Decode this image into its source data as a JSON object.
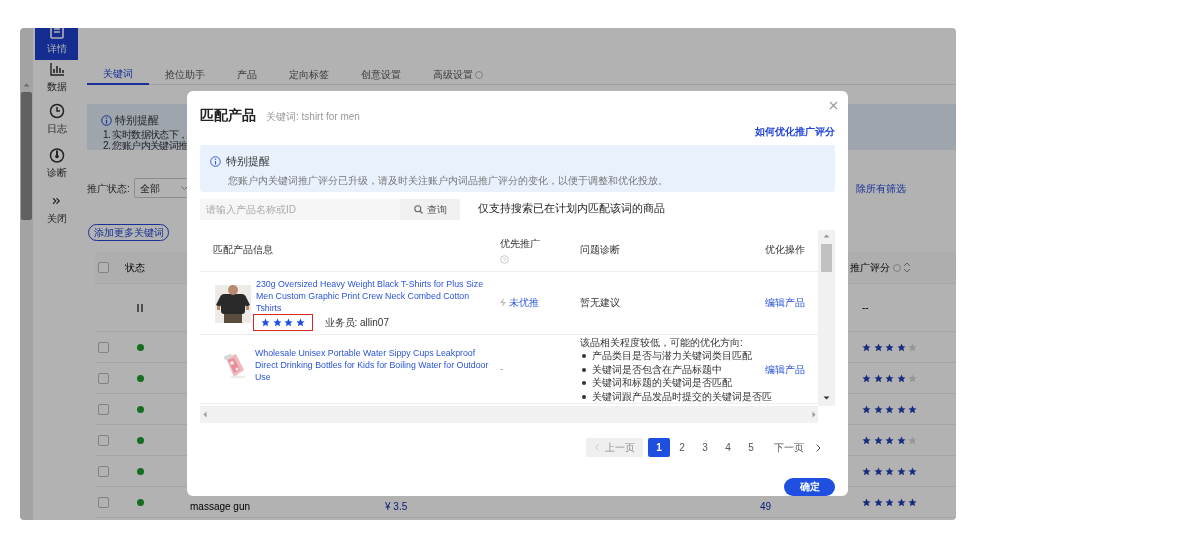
{
  "sidebar": {
    "items": [
      {
        "label": "详情",
        "kind": "document",
        "selected": true
      },
      {
        "label": "数据",
        "kind": "chart",
        "selected": false
      },
      {
        "label": "日志",
        "kind": "clock",
        "selected": false
      },
      {
        "label": "诊断",
        "kind": "gauge",
        "selected": false
      },
      {
        "label": "关闭",
        "kind": "collapse",
        "selected": false
      }
    ]
  },
  "tabs": [
    {
      "label": "关键词",
      "selected": true
    },
    {
      "label": "抢位助手",
      "selected": false
    },
    {
      "label": "产品",
      "selected": false
    },
    {
      "label": "定向标签",
      "selected": false
    },
    {
      "label": "创意设置",
      "selected": false
    },
    {
      "label": "高级设置",
      "selected": false,
      "help": true
    }
  ],
  "notice": {
    "title": "特别提醒",
    "lines": [
      "1. 实时数据状态下，",
      "2. 您账户内关键词推"
    ]
  },
  "filter": {
    "label": "推广状态:",
    "value": "全部",
    "clear": "除所有筛选"
  },
  "add_button": "添加更多关键词",
  "keyword_table": {
    "select_all": {
      "checked": false
    },
    "status_header": "状态",
    "score_header": "推广评分",
    "rows": [
      {
        "paused": true,
        "score": "--"
      },
      {
        "paused": false,
        "checked": false,
        "stars": 4
      },
      {
        "paused": false,
        "checked": false,
        "stars": 4
      },
      {
        "paused": false,
        "checked": false,
        "stars": 5
      },
      {
        "paused": false,
        "checked": false,
        "stars": 4
      },
      {
        "paused": false,
        "checked": false,
        "stars": 5
      },
      {
        "paused": false,
        "checked": false,
        "name": "massage gun",
        "price": "¥ 3.5",
        "column_6": "49",
        "stars": 5
      }
    ]
  },
  "modal": {
    "title": "匹配产品",
    "keyword": "关键词: tshirt for men",
    "help_link": "如何优化推广评分",
    "notice": {
      "title": "特别提醒",
      "text": "您账户内关键词推广评分已升级，请及时关注账户内词品推广评分的变化，以便于调整和优化投放。"
    },
    "search": {
      "placeholder": "请输入产品名称或ID",
      "button": "查询",
      "note": "仅支持搜索已在计划内匹配该词的商品"
    },
    "columns": [
      {
        "label": "匹配产品信息"
      },
      {
        "label": "优先推广",
        "help": true
      },
      {
        "label": "问题诊断"
      },
      {
        "label": "优化操作"
      }
    ],
    "rows": [
      {
        "image": {
          "kind": "picture"
        },
        "title": "230g Oversized Heavy Weight Black T-Shirts for Plus Size Men Custom Graphic Print Crew Neck Combed Cotton Tshirts",
        "stars": 4,
        "highlighted": true,
        "salesperson": "业务员: allin07",
        "priority": "未优推",
        "priority_active": true,
        "diagnosis": "暂无建议",
        "action": "编辑产品"
      },
      {
        "image": {
          "kind": "picture"
        },
        "title": "Wholesale Unisex Portable Water Sippy Cups Leakproof Direct Drinking Bottles for Kids for Boiling Water for Outdoor Use",
        "priority": "-",
        "priority_active": false,
        "diagnosis": "该品相关程度较低，可能的优化方向:",
        "suggestions": [
          "产品类目是否与潜力关键词类目匹配",
          "关键词是否包含在产品标题中",
          "关键词和标题的关键词是否匹配",
          "关键词跟产品发品时提交的关键词是否匹"
        ],
        "action": "编辑产品"
      }
    ],
    "pagination": {
      "prev": "上一页",
      "prev_disabled": true,
      "pages": [
        {
          "label": "1",
          "selected": true
        },
        {
          "label": "2",
          "selected": false
        },
        {
          "label": "3",
          "selected": false
        },
        {
          "label": "4",
          "selected": false
        },
        {
          "label": "5",
          "selected": false
        }
      ],
      "next": "下一页"
    },
    "confirm": "确定"
  }
}
